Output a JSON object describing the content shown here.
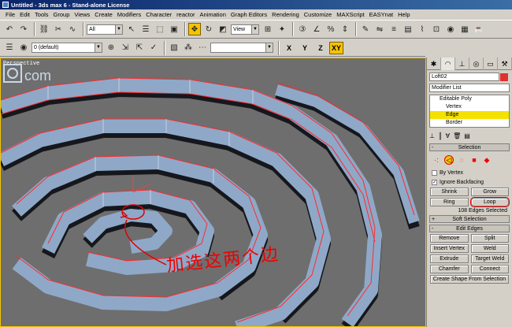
{
  "titlebar": {
    "title": "Untitled - 3ds max 6 - Stand-alone License"
  },
  "menubar": {
    "items": [
      "File",
      "Edit",
      "Tools",
      "Group",
      "Views",
      "Create",
      "Modifiers",
      "Character",
      "reactor",
      "Animation",
      "Graph Editors",
      "Rendering",
      "Customize",
      "MAXScript",
      "EASYnat",
      "Help"
    ]
  },
  "toolbar": {
    "selection_filter": "All",
    "ref_coord": "View",
    "layer": "0 (default)",
    "axes": [
      "X",
      "Y",
      "Z",
      "XY"
    ],
    "active_axis": "XY"
  },
  "viewport": {
    "label": "Perspective",
    "annotation": "加选这两个边"
  },
  "command_panel": {
    "object_name": "Loft02",
    "modifier_list": "Modifier List",
    "stack": [
      "Editable Poly",
      "Vertex",
      "Edge",
      "Border"
    ],
    "selected_stack_item": "Edge",
    "selection": {
      "title": "Selection",
      "by_vertex": "By Vertex",
      "ignore_backfacing": "Ignore Backfacing",
      "ignore_backfacing_checked": true,
      "shrink": "Shrink",
      "grow": "Grow",
      "ring": "Ring",
      "loop": "Loop",
      "status": "108 Edges Selected"
    },
    "soft_selection": {
      "title": "Soft Selection"
    },
    "edit_edges": {
      "title": "Edit Edges",
      "remove": "Remove",
      "split": "Split",
      "insert_vertex": "Insert Vertex",
      "weld": "Weld",
      "extrude": "Extrude",
      "target_weld": "Target Weld",
      "chamfer": "Chamfer",
      "connect": "Connect",
      "create_shape": "Create Shape From Selection"
    }
  },
  "colors": {
    "accent": "#f5c400",
    "annotation": "#e00000",
    "object": "#8fa8c8",
    "viewport_bg": "#6e6e6e"
  }
}
